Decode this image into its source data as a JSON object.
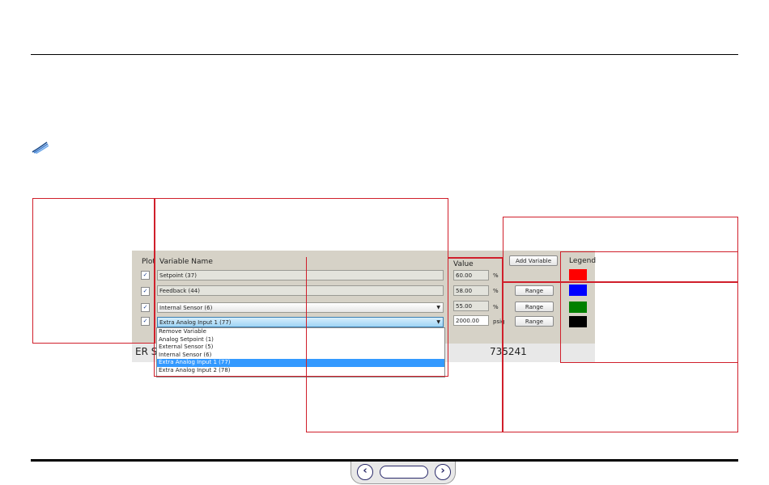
{
  "panel": {
    "headers": {
      "plot": "Plot",
      "variable_name": "Variable Name",
      "value": "Value",
      "legend": "Legend"
    },
    "add_variable_label": "Add Variable",
    "rows": [
      {
        "checked": true,
        "checkmark": "✓",
        "variable": "Setpoint (37)",
        "value": "60.00",
        "unit": "%",
        "has_range": false,
        "legend_color": "#ff0000",
        "kind": "field"
      },
      {
        "checked": true,
        "checkmark": "✓",
        "variable": "Feedback (44)",
        "value": "58.00",
        "unit": "%",
        "has_range": true,
        "range_label": "Range",
        "legend_color": "#0000ff",
        "kind": "field"
      },
      {
        "checked": true,
        "checkmark": "✓",
        "variable": "Internal Sensor (6)",
        "value": "55.00",
        "unit": "%",
        "has_range": true,
        "range_label": "Range",
        "legend_color": "#008000",
        "kind": "combo"
      },
      {
        "checked": true,
        "checkmark": "✓",
        "variable": "Extra Analog Input 1 (77)",
        "value": "2000.00",
        "unit": "psig",
        "has_range": true,
        "range_label": "Range",
        "legend_color": "#000000",
        "kind": "combo-active"
      }
    ],
    "dropdown_options": [
      "Remove Variable",
      "Analog Setpoint (1)",
      "External Sensor (5)",
      "Internal Sensor (6)",
      "Extra Analog Input 1 (77)",
      "Extra Analog Input 2 (78)"
    ],
    "dropdown_selected": "Extra Analog Input 1 (77)",
    "bottom_left_text": "ER Se",
    "bottom_number": "735241"
  },
  "nav": {
    "prev_glyph": "‹",
    "next_glyph": "›"
  },
  "colors": {
    "highlight": "#d01f2b",
    "selection": "#3399ff"
  }
}
